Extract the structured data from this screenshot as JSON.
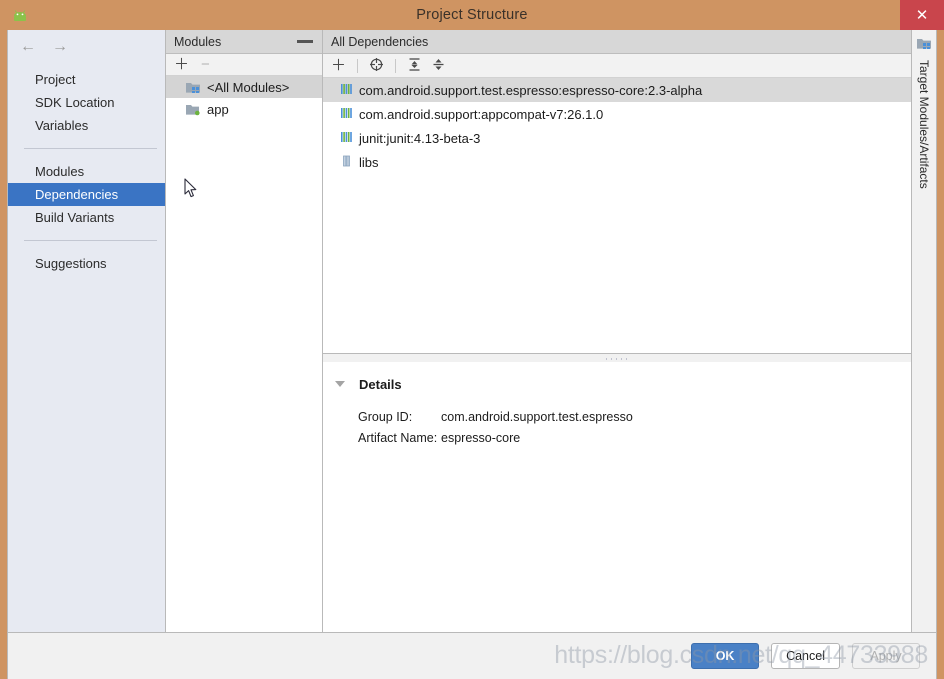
{
  "window": {
    "title": "Project Structure",
    "app_icon": "android-icon",
    "close_label": "✕"
  },
  "sidebar": {
    "back_icon": "arrow-left-icon",
    "forward_icon": "arrow-right-icon",
    "groups": [
      {
        "items": [
          {
            "label": "Project",
            "selected": false
          },
          {
            "label": "SDK Location",
            "selected": false
          },
          {
            "label": "Variables",
            "selected": false
          }
        ]
      },
      {
        "items": [
          {
            "label": "Modules",
            "selected": false
          },
          {
            "label": "Dependencies",
            "selected": true
          },
          {
            "label": "Build Variants",
            "selected": false
          }
        ]
      },
      {
        "items": [
          {
            "label": "Suggestions",
            "selected": false
          }
        ]
      }
    ],
    "selected_color": "#3a74c4"
  },
  "modules_panel": {
    "header": "Modules",
    "minimize_icon": "minimize-icon",
    "toolbar": [
      {
        "icon": "plus-icon",
        "glyph": "＋",
        "disabled": false
      },
      {
        "icon": "minus-icon",
        "glyph": "−",
        "disabled": true
      }
    ],
    "items": [
      {
        "label": "<All Modules>",
        "icon": "all-modules-icon",
        "selected": true
      },
      {
        "label": "app",
        "icon": "module-icon",
        "selected": false
      }
    ]
  },
  "dependencies_panel": {
    "header": "All Dependencies",
    "toolbar": [
      {
        "icon": "plus-icon",
        "glyph": "＋"
      },
      {
        "icon": "scope-target-icon",
        "glyph": "⊕"
      },
      {
        "icon": "expand-all-icon",
        "glyph": "⨋"
      },
      {
        "icon": "collapse-all-icon",
        "glyph": "⨌"
      }
    ],
    "items": [
      {
        "label": "com.android.support.test.espresso:espresso-core:2.3-alpha",
        "icon": "library-icon",
        "selected": true
      },
      {
        "label": "com.android.support:appcompat-v7:26.1.0",
        "icon": "library-icon",
        "selected": false
      },
      {
        "label": "junit:junit:4.13-beta-3",
        "icon": "library-icon",
        "selected": false
      },
      {
        "label": "libs",
        "icon": "jar-folder-icon",
        "selected": false
      }
    ]
  },
  "details": {
    "title": "Details",
    "collapse_icon": "triangle-down-icon",
    "fields": [
      {
        "label": "Group ID:",
        "value": "com.android.support.test.espresso"
      },
      {
        "label": "Artifact Name:",
        "value": "espresso-core"
      }
    ]
  },
  "right_strip": {
    "tab_icon": "target-modules-icon",
    "tab_label": "Target Modules/Artifacts"
  },
  "footer": {
    "buttons": [
      {
        "label": "OK",
        "style": "primary"
      },
      {
        "label": "Cancel",
        "style": "default"
      },
      {
        "label": "Apply",
        "style": "disabled"
      }
    ]
  },
  "watermark": {
    "text": "https://blog.csdn.net/qq_44733988"
  }
}
